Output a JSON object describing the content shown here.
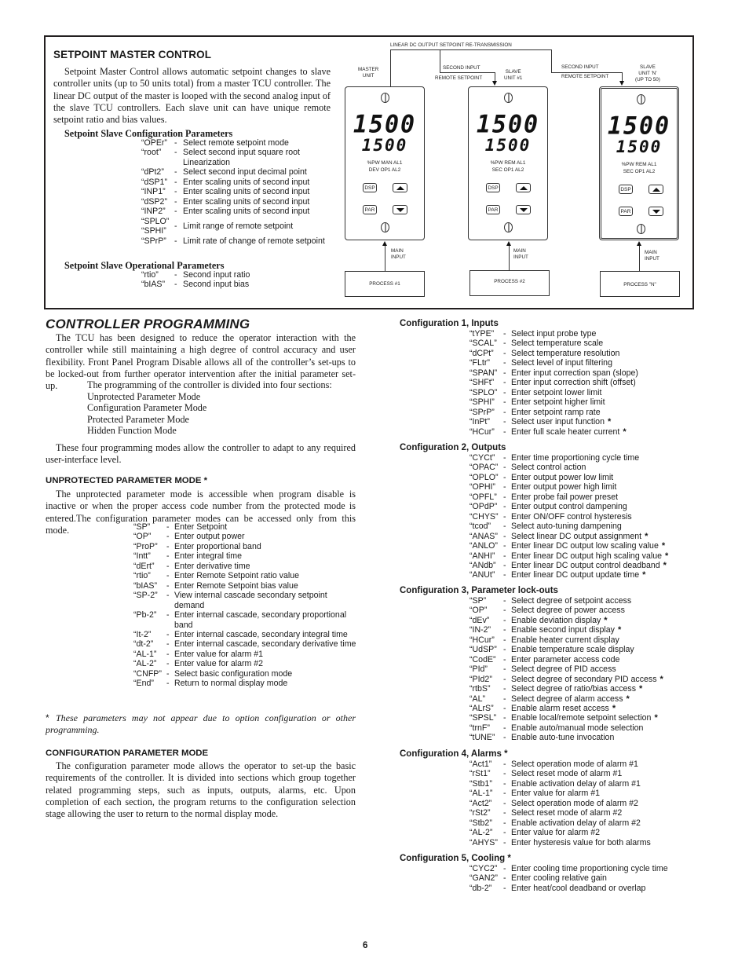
{
  "setpoint_master": {
    "title": "SETPOINT MASTER CONTROL",
    "paragraph": "Setpoint Master Control allows automatic setpoint changes to slave controller units (up to 50 units total) from a master TCU controller. The linear DC output of the master is looped with the second analog input of the slave TCU controllers. Each slave unit can have unique remote setpoint ratio and bias values.",
    "config_title": "Setpoint Slave Configuration Parameters",
    "config_params": [
      {
        "code": "“OPEr”",
        "desc": "Select remote setpoint mode"
      },
      {
        "code": "“root”",
        "desc": "Select second input square root Linearization"
      },
      {
        "code": "“dPt2”",
        "desc": "Select second input decimal point"
      },
      {
        "code": "“dSP1”",
        "desc": "Enter scaling units of second input"
      },
      {
        "code": "“INP1”",
        "desc": "Enter scaling units of second input"
      },
      {
        "code": "“dSP2”",
        "desc": "Enter scaling units of second input"
      },
      {
        "code": "“INP2”",
        "desc": "Enter scaling units of second input"
      },
      {
        "code": "“SPLO” “SPHI”",
        "desc": "Limit range of remote setpoint"
      },
      {
        "code": "“SPrP”",
        "desc": "Limit rate of change of remote setpoint"
      }
    ],
    "operational_title": "Setpoint Slave Operational Parameters",
    "operational_params": [
      {
        "code": "“rtio”",
        "desc": "Second input ratio"
      },
      {
        "code": "“bIAS”",
        "desc": "Second input bias"
      }
    ]
  },
  "diagram": {
    "top_label": "LINEAR DC OUTPUT SETPOINT RE-TRANSMISSION",
    "second_input_label": "SECOND INPUT",
    "remote_setpoint_label": "REMOTE SETPOINT",
    "main_input_label_line1": "MAIN",
    "main_input_label_line2": "INPUT",
    "units": [
      {
        "label_lines": [
          "MASTER",
          "UNIT"
        ],
        "display_top": "1500",
        "display_bottom": "1500",
        "annunciators_row1": "%PW  MAN  AL1",
        "annunciators_row2": "DEV  OP1  AL2",
        "process": "PROCESS #1"
      },
      {
        "label_lines": [
          "SLAVE",
          "UNIT #1"
        ],
        "display_top": "1500",
        "display_bottom": "1500",
        "annunciators_row1": "%PW  REM  AL1",
        "annunciators_row2": "SEC  OP1  AL2",
        "process": "PROCESS #2"
      },
      {
        "label_lines": [
          "SLAVE",
          "UNIT 'N'",
          "(UP TO 50)"
        ],
        "display_top": "1500",
        "display_bottom": "1500",
        "annunciators_row1": "%PW  REM  AL1",
        "annunciators_row2": "SEC  OP1  AL2",
        "process": "PROCESS \"N\""
      }
    ],
    "buttons": {
      "dsp": "DSP",
      "par": "PAR"
    }
  },
  "controller_programming": {
    "title": "CONTROLLER PROGRAMMING",
    "paragraph1": "The TCU has been designed to reduce the operator interaction with the controller while still maintaining a high degree of control accuracy and user flexibility. Front Panel Program Disable allows all of the controller’s set-ups to be locked-out from further operator intervention after the initial parameter set-up.",
    "sections_intro": "The programming of the controller is divided into four sections:",
    "sections": [
      "Unprotected Parameter Mode",
      "Configuration Parameter Mode",
      "Protected Parameter Mode",
      "Hidden Function Mode"
    ],
    "paragraph2": "These four programming modes allow the controller to adapt to any required user-interface level."
  },
  "unprotected_mode": {
    "title": "UNPROTECTED PARAMETER MODE *",
    "paragraph": "The unprotected parameter mode is accessible when program disable is inactive or when the proper access code number from the protected mode is entered.The configuration parameter modes can be accessed only from this mode.",
    "params": [
      {
        "code": "“SP”",
        "desc": "Enter Setpoint"
      },
      {
        "code": "“OP”",
        "desc": "Enter output power"
      },
      {
        "code": "“ProP”",
        "desc": "Enter proportional band"
      },
      {
        "code": "“Intt”",
        "desc": "Enter integral time"
      },
      {
        "code": "“dErt”",
        "desc": "Enter derivative time"
      },
      {
        "code": "“rtio”",
        "desc": "Enter Remote Setpoint ratio value"
      },
      {
        "code": "“bIAS”",
        "desc": "Enter Remote Setpoint bias value"
      },
      {
        "code": "“SP-2”",
        "desc": "View internal cascade secondary setpoint demand"
      },
      {
        "code": "“Pb-2”",
        "desc": "Enter internal cascade, secondary proportional band"
      },
      {
        "code": "“It-2”",
        "desc": "Enter internal cascade, secondary integral time"
      },
      {
        "code": "“dt-2”",
        "desc": "Enter internal cascade, secondary derivative time"
      },
      {
        "code": "“AL-1”",
        "desc": "Enter value for alarm #1"
      },
      {
        "code": "“AL-2”",
        "desc": "Enter value for alarm #2"
      },
      {
        "code": "“CNFP”",
        "desc": "Select basic configuration mode"
      },
      {
        "code": "“End”",
        "desc": "Return to normal display mode"
      }
    ],
    "note_star": "*",
    "note": "These parameters may not appear due to option configuration or other programming."
  },
  "configuration_mode": {
    "title": "CONFIGURATION PARAMETER MODE",
    "paragraph": "The configuration parameter mode allows the operator to set-up the basic requirements of the controller. It is divided into sections which group together related programming steps, such as inputs, outputs, alarms, etc. Upon completion of each section, the program returns to the configuration selection stage allowing the user to return to the normal display mode."
  },
  "configurations": [
    {
      "title": "Configuration 1, Inputs",
      "params": [
        {
          "code": "“tYPE”",
          "desc": "Select input probe type",
          "star": ""
        },
        {
          "code": "“SCAL”",
          "desc": "Select temperature scale",
          "star": ""
        },
        {
          "code": "“dCPt”",
          "desc": "Select temperature resolution",
          "star": ""
        },
        {
          "code": "“FLtr”",
          "desc": "Select level of input filtering",
          "star": ""
        },
        {
          "code": "“SPAN”",
          "desc": "Enter input correction span (slope)",
          "star": ""
        },
        {
          "code": "“SHFt”",
          "desc": "Enter input correction shift (offset)",
          "star": ""
        },
        {
          "code": "“SPLO”",
          "desc": "Enter setpoint lower limit",
          "star": ""
        },
        {
          "code": "“SPHI”",
          "desc": "Enter setpoint higher limit",
          "star": ""
        },
        {
          "code": "“SPrP”",
          "desc": "Enter setpoint ramp rate",
          "star": ""
        },
        {
          "code": "“InPt”",
          "desc": "Select user input function",
          "star": "*"
        },
        {
          "code": "“HCur”",
          "desc": "Enter full scale heater current",
          "star": "*"
        }
      ]
    },
    {
      "title": "Configuration 2, Outputs",
      "params": [
        {
          "code": "“CYCt”",
          "desc": "Enter time proportioning cycle time",
          "star": ""
        },
        {
          "code": "“OPAC”",
          "desc": "Select control action",
          "star": ""
        },
        {
          "code": "“OPLO”",
          "desc": "Enter output power low limit",
          "star": ""
        },
        {
          "code": "“OPHI”",
          "desc": "Enter output power high limit",
          "star": ""
        },
        {
          "code": "“OPFL”",
          "desc": "Enter probe fail power preset",
          "star": ""
        },
        {
          "code": "“OPdP”",
          "desc": "Enter output control dampening",
          "star": ""
        },
        {
          "code": "“CHYS”",
          "desc": "Enter ON/OFF control hysteresis",
          "star": ""
        },
        {
          "code": "“tcod”",
          "desc": "Select auto-tuning dampening",
          "star": ""
        },
        {
          "code": "“ANAS”",
          "desc": "Select linear DC output assignment",
          "star": "*"
        },
        {
          "code": "“ANLO”",
          "desc": "Enter linear DC output low scaling value",
          "star": "*"
        },
        {
          "code": "“ANHI”",
          "desc": "Enter linear DC output high scaling value",
          "star": "*"
        },
        {
          "code": "“ANdb”",
          "desc": "Enter linear DC output control deadband",
          "star": "*"
        },
        {
          "code": "“ANUt”",
          "desc": "Enter linear DC output update time",
          "star": "*"
        }
      ]
    },
    {
      "title": "Configuration 3, Parameter lock-outs",
      "params": [
        {
          "code": "“SP”",
          "desc": "Select degree of setpoint access",
          "star": ""
        },
        {
          "code": "“OP”",
          "desc": "Select degree of power access",
          "star": ""
        },
        {
          "code": "“dEv”",
          "desc": "Enable deviation display",
          "star": "*"
        },
        {
          "code": "“IN-2”",
          "desc": "Enable second input display",
          "star": "*"
        },
        {
          "code": "“HCur”",
          "desc": "Enable heater current display",
          "star": ""
        },
        {
          "code": "“UdSP”",
          "desc": "Enable temperature scale display",
          "star": ""
        },
        {
          "code": "“CodE”",
          "desc": "Enter parameter access code",
          "star": ""
        },
        {
          "code": "“PId”",
          "desc": "Select degree of PID access",
          "star": ""
        },
        {
          "code": "“PId2”",
          "desc": "Select degree of secondary PID access",
          "star": "*"
        },
        {
          "code": "“rtbS”",
          "desc": "Select degree of ratio/bias access",
          "star": "*"
        },
        {
          "code": "“AL”",
          "desc": "Select degree of alarm access",
          "star": "*"
        },
        {
          "code": "“ALrS”",
          "desc": "Enable alarm reset access",
          "star": "*"
        },
        {
          "code": "“SPSL”",
          "desc": "Enable local/remote setpoint selection",
          "star": "*"
        },
        {
          "code": "“trnF”",
          "desc": "Enable auto/manual mode selection",
          "star": ""
        },
        {
          "code": "“tUNE”",
          "desc": "Enable auto-tune invocation",
          "star": ""
        }
      ]
    },
    {
      "title": "Configuration 4, Alarms *",
      "params": [
        {
          "code": "“Act1”",
          "desc": "Select operation mode of alarm #1",
          "star": ""
        },
        {
          "code": "“rSt1”",
          "desc": "Select reset mode of alarm #1",
          "star": ""
        },
        {
          "code": "“Stb1”",
          "desc": "Enable activation delay of alarm #1",
          "star": ""
        },
        {
          "code": "“AL-1”",
          "desc": "Enter value for alarm #1",
          "star": ""
        },
        {
          "code": "“Act2”",
          "desc": "Select operation mode of alarm #2",
          "star": ""
        },
        {
          "code": "“rSt2”",
          "desc": "Select reset mode of alarm #2",
          "star": ""
        },
        {
          "code": "“Stb2”",
          "desc": "Enable activation delay of alarm #2",
          "star": ""
        },
        {
          "code": "“AL-2”",
          "desc": "Enter value for alarm #2",
          "star": ""
        },
        {
          "code": "“AHYS”",
          "desc": "Enter hysteresis value for both alarms",
          "star": ""
        }
      ]
    },
    {
      "title": "Configuration 5, Cooling *",
      "params": [
        {
          "code": "“CYC2”",
          "desc": "Enter cooling time proportioning cycle time",
          "star": ""
        },
        {
          "code": "“GAN2”",
          "desc": "Enter cooling relative gain",
          "star": ""
        },
        {
          "code": "“db-2”",
          "desc": "Enter heat/cool deadband or overlap",
          "star": ""
        }
      ]
    }
  ],
  "page_number": "6"
}
